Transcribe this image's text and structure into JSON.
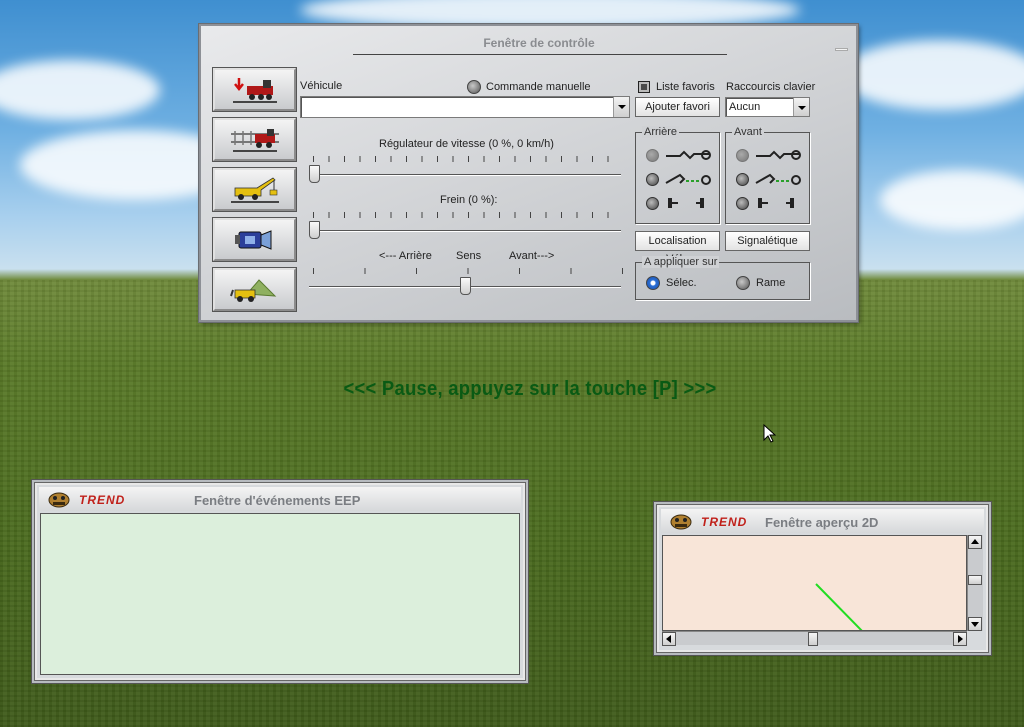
{
  "control_window": {
    "title": "Fenêtre de contrôle",
    "vehicle_label": "Véhicule",
    "vehicle_value": "",
    "manual_command_label": "Commande manuelle",
    "favorites_label": "Liste favoris",
    "add_favorite_label": "Ajouter favori",
    "shortcuts_label": "Raccourcis clavier",
    "shortcuts_value": "Aucun",
    "speed_label": "Régulateur de vitesse (0 %, 0 km/h)",
    "speed_fraction": 0.0,
    "brake_label": "Frein (0 %):",
    "brake_fraction": 0.0,
    "direction_back_label": "<--- Arrière",
    "direction_label": "Sens",
    "direction_forward_label": "Avant--->",
    "direction_fraction": 0.5,
    "rear_group_label": "Arrière",
    "front_group_label": "Avant",
    "locate_vehicle_label": "Localisation Véh.",
    "signals_label": "Signalétique",
    "apply_to_label": "A appliquer sur",
    "apply_select_label": "Sélec.",
    "apply_train_label": "Rame",
    "side_buttons": [
      "locomotive-icon",
      "train-track-icon",
      "crane-icon",
      "camera-icon",
      "landscape-icon"
    ]
  },
  "pause_message": "<<<  Pause, appuyez sur la touche [P]  >>>",
  "events_window": {
    "brand": "TREND",
    "title": "Fenêtre d'événements EEP"
  },
  "preview_window": {
    "brand": "TREND",
    "title": "Fenêtre aperçu 2D"
  },
  "colors": {
    "events_bg": "#dcefdc",
    "preview_bg": "#f8e5d8",
    "pause_text": "#0a5a14",
    "track_line": "#22dd22"
  }
}
